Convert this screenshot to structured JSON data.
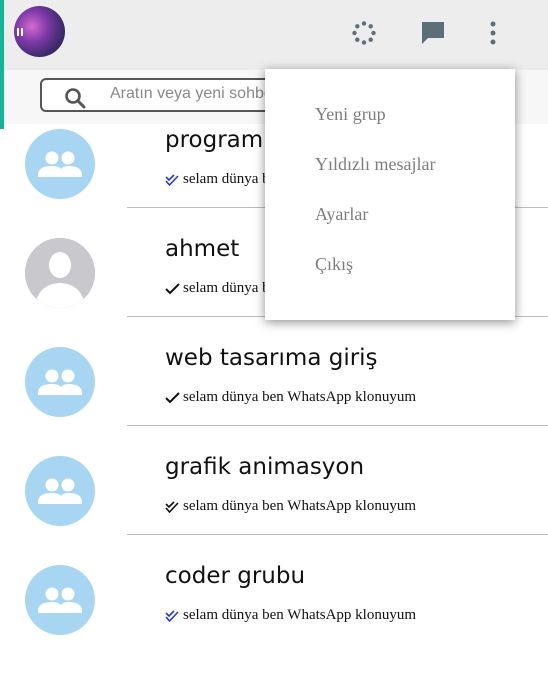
{
  "search": {
    "placeholder": "Aratın veya yeni sohbet başlatın"
  },
  "chats": [
    {
      "name": "programlama",
      "message": "selam dünya ben WhatsApp klonuyum",
      "status": "read",
      "avatar": "group"
    },
    {
      "name": "ahmet",
      "message": "selam dünya ben WhatsApp klonuyum",
      "status": "sent",
      "avatar": "person"
    },
    {
      "name": "web tasarıma giriş",
      "message": "selam dünya ben WhatsApp klonuyum",
      "status": "sent",
      "avatar": "group"
    },
    {
      "name": "grafik animasyon",
      "message": "selam dünya ben WhatsApp klonuyum",
      "status": "delivered",
      "avatar": "group"
    },
    {
      "name": "coder grubu",
      "message": "selam dünya ben WhatsApp klonuyum",
      "status": "read",
      "avatar": "group"
    }
  ],
  "menu": {
    "items": [
      "Yeni grup",
      "Yıldızlı mesajlar",
      "Ayarlar",
      "Çıkış"
    ]
  },
  "icons": {
    "status": "status-icon",
    "new_chat": "chat-icon",
    "more": "more-vertical-icon",
    "search": "search-icon"
  },
  "colors": {
    "accent": "#14b596",
    "read_tick": "#2b3bd6",
    "group_avatar": "#a8d6f2",
    "header_bg": "#ededed"
  }
}
